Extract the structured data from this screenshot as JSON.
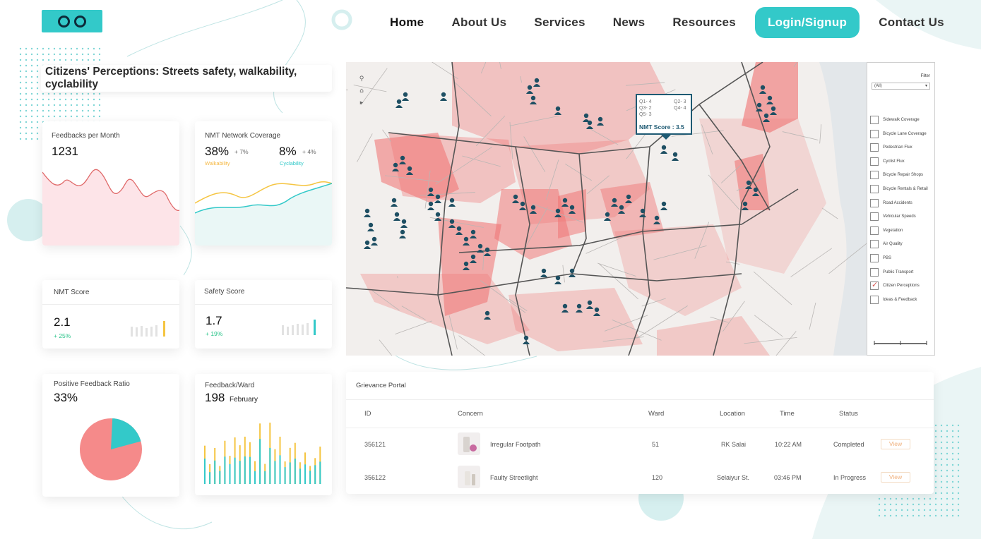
{
  "nav": {
    "items": [
      "Home",
      "About Us",
      "Services",
      "News",
      "Resources",
      "Login/Signup",
      "Contact Us"
    ]
  },
  "title": "Citizens' Perceptions: Streets safety, walkability, cyclability",
  "cards": {
    "feedbacks": {
      "label": "Feedbacks per Month",
      "value": "1231"
    },
    "coverage": {
      "label": "NMT Network Coverage",
      "walk_value": "38%",
      "walk_delta": "+ 7%",
      "walk_label": "Walkability",
      "cycle_value": "8%",
      "cycle_delta": "+ 4%",
      "cycle_label": "Cyclability"
    },
    "nmt": {
      "label": "NMT Score",
      "value": "2.1",
      "delta": "+ 25%"
    },
    "safety": {
      "label": "Safety Score",
      "value": "1.7",
      "delta": "+ 19%"
    },
    "positive": {
      "label": "Positive Feedback Ratio",
      "value": "33%",
      "fraction": 0.2
    },
    "ward": {
      "label": "Feedback/Ward",
      "value": "198",
      "month": "February"
    }
  },
  "map": {
    "tooltip": {
      "q1": "Q1- 4",
      "q2": "Q2- 3",
      "q3": "Q3- 2",
      "q4": "Q4- 4",
      "q5": "Q5- 3",
      "score": "NMT Score : 3.5"
    },
    "filter_label": "Filter",
    "filter_value": "(All)",
    "layers": [
      {
        "label": "Sidewalk Coverage",
        "checked": false
      },
      {
        "label": "Bicycle Lane Coverage",
        "checked": false
      },
      {
        "label": "Pedestrian Flux",
        "checked": false
      },
      {
        "label": "Cyclist Flux",
        "checked": false
      },
      {
        "label": "Bicycle Repair Shops",
        "checked": false
      },
      {
        "label": "Bicycle Rentals & Retail",
        "checked": false
      },
      {
        "label": "Road Accidents",
        "checked": false
      },
      {
        "label": "Vehicular Speeds",
        "checked": false
      },
      {
        "label": "Vegetation",
        "checked": false
      },
      {
        "label": "Air Quality",
        "checked": false
      },
      {
        "label": "PBS",
        "checked": false
      },
      {
        "label": "Public Transport",
        "checked": false
      },
      {
        "label": "Citizen Perceptions",
        "checked": true
      },
      {
        "label": "Ideas & Feedback",
        "checked": false
      }
    ]
  },
  "grievance": {
    "title": "Grievance Portal",
    "headers": [
      "ID",
      "Concern",
      "Ward",
      "Location",
      "Time",
      "Status"
    ],
    "rows": [
      {
        "id": "356121",
        "concern": "Irregular Footpath",
        "ward": "51",
        "location": "RK Salai",
        "time": "10:22 AM",
        "status": "Completed",
        "action": "View"
      },
      {
        "id": "356122",
        "concern": "Faulty Streetlight",
        "ward": "120",
        "location": "Selaiyur St.",
        "time": "03:46 PM",
        "status": "In Progress",
        "action": "View"
      }
    ]
  },
  "colors": {
    "accent": "#33c9c9",
    "dark": "#0d2b3a",
    "pink": "#f08a8a",
    "yellow": "#f5c542",
    "green": "#2bc48a"
  }
}
